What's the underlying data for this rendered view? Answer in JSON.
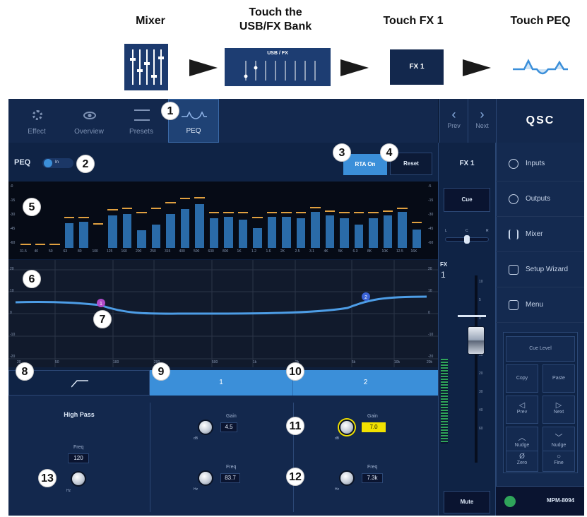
{
  "steps": {
    "s1": "Mixer",
    "s2a": "Touch the",
    "s2b": "USB/FX Bank",
    "s3": "Touch FX 1",
    "s4": "Touch PEQ"
  },
  "thumbs": {
    "usbfx": "USB / FX",
    "fx1": "FX 1"
  },
  "tabs": {
    "effect": "Effect",
    "overview": "Overview",
    "presets": "Presets",
    "peq": "PEQ"
  },
  "nav": {
    "prev": "Prev",
    "next": "Next"
  },
  "brand": "QSC",
  "peq": {
    "label": "PEQ",
    "toggle": "In",
    "rta": "RTA On",
    "reset": "Reset"
  },
  "rta": {
    "freqs": [
      "31.5",
      "40",
      "50",
      "63",
      "80",
      "100",
      "125",
      "160",
      "200",
      "250",
      "315",
      "400",
      "500",
      "630",
      "800",
      "1K",
      "1.2",
      "1.6",
      "2K",
      "2.5",
      "3.1",
      "4K",
      "5K",
      "6.3",
      "8K",
      "10K",
      "12.5",
      "16K"
    ],
    "ticks_left": [
      "-0",
      "-15",
      "-30",
      "-45",
      "-60"
    ],
    "ticks_right": [
      "-5",
      "-15",
      "-30",
      "-45",
      "-60"
    ],
    "levels": [
      0,
      0,
      0,
      40,
      42,
      0,
      52,
      55,
      28,
      38,
      55,
      62,
      70,
      48,
      50,
      45,
      32,
      50,
      50,
      48,
      58,
      52,
      48,
      38,
      48,
      52,
      58,
      30
    ],
    "peaks": [
      4,
      4,
      4,
      48,
      48,
      38,
      60,
      63,
      56,
      62,
      72,
      78,
      80,
      56,
      56,
      56,
      48,
      56,
      56,
      56,
      64,
      58,
      56,
      56,
      56,
      58,
      62,
      40
    ]
  },
  "eqgraph": {
    "y_ticks": [
      "20",
      "10",
      "0",
      "-10",
      "-20"
    ],
    "x_ticks": [
      "20",
      "50",
      "100",
      "200",
      "500",
      "1k",
      "2k",
      "5k",
      "10k",
      "20k"
    ],
    "node1": "1",
    "node2": "2"
  },
  "bands": {
    "b0": "⌐",
    "b1": "1",
    "b2": "2"
  },
  "filter": {
    "title": "High Pass",
    "freq_label": "Freq",
    "freq_value": "120",
    "unit": "Hz"
  },
  "band1": {
    "gain_label": "Gain",
    "gain_value": "4.5",
    "gain_unit": "dB",
    "freq_label": "Freq",
    "freq_value": "83.7",
    "freq_unit": "Hz"
  },
  "band2": {
    "gain_label": "Gain",
    "gain_value": "7.0",
    "gain_unit": "dB",
    "freq_label": "Freq",
    "freq_value": "7.3k",
    "freq_unit": "Hz"
  },
  "channel": {
    "name": "FX 1",
    "cue": "Cue",
    "pan_l": "L",
    "pan_c": "C",
    "pan_r": "R",
    "fx_label": "FX",
    "fx_num": "1",
    "mute": "Mute",
    "fader_ticks": [
      "10",
      "5",
      "0",
      "5",
      "10",
      "20",
      "30",
      "40",
      "60"
    ]
  },
  "sidebar": {
    "inputs": "Inputs",
    "outputs": "Outputs",
    "mixer": "Mixer",
    "setup": "Setup Wizard",
    "menu": "Menu"
  },
  "keypad": {
    "cue_level": "Cue Level",
    "copy": "Copy",
    "paste": "Paste",
    "prev": "Prev",
    "next": "Next",
    "nudge_up": "Nudge",
    "nudge_down": "Nudge",
    "zero": "Zero",
    "fine": "Fine"
  },
  "device": "MPM-8094",
  "callouts": [
    "1",
    "2",
    "3",
    "4",
    "5",
    "6",
    "7",
    "8",
    "9",
    "10",
    "11",
    "12",
    "13"
  ],
  "colors": {
    "accent": "#3b8fd9",
    "bg": "#0e1f3c",
    "highlight": "#f2e200",
    "node1": "#b04ac8",
    "node2": "#3a62d6"
  }
}
